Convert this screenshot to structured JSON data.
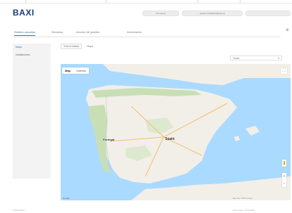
{
  "brand": {
    "name": "BAXI"
  },
  "header": {
    "user_pill": "Mi cuenta",
    "email_pill": "usuario.instalador@baxi.es",
    "search_pill": ""
  },
  "tabs": [
    {
      "label": "Gestión usuarios",
      "active": true
    },
    {
      "label": "Servicios",
      "active": false
    },
    {
      "label": "Informe de gestión",
      "active": false
    },
    {
      "label": "Información",
      "active": false
    }
  ],
  "sidebar": {
    "items": [
      {
        "label": "Mapa",
        "active": true
      },
      {
        "label": "Instalaciones",
        "active": false
      }
    ]
  },
  "breadcrumb": {
    "items": [
      "Todo el listado",
      "Mapa"
    ]
  },
  "filter": {
    "selected": "Todas"
  },
  "map": {
    "toggle_map": "Map",
    "toggle_satellite": "Satellite",
    "country_label": "Spain",
    "portugal_label": "Portugal",
    "attribution": "Map data ©2018 Google",
    "google": "Google",
    "colors": {
      "water": "#aadaff",
      "land": "#f2efe9",
      "green": "#c8dfb6",
      "road": "#f4c06b"
    }
  },
  "footer": {
    "left": "©2018 BAXI",
    "right": "Aviso legal · Privacidad"
  }
}
